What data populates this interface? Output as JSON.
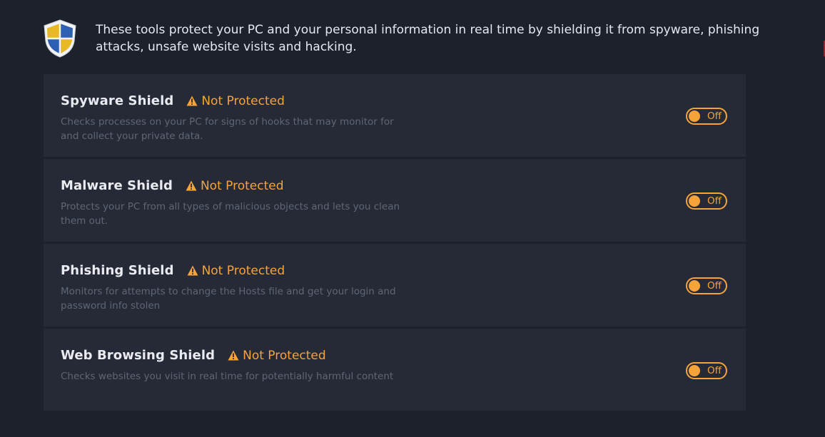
{
  "header": {
    "description": "These tools protect your PC and your personal information in real time by shielding it from spyware, phishing attacks, unsafe website visits and hacking.",
    "logo_icon": "shield-logo-icon"
  },
  "colors": {
    "background": "#1d212c",
    "card": "#262a37",
    "accent": "#f6a33a",
    "title": "#e9ebf0",
    "description": "#5f6677"
  },
  "shields": [
    {
      "title": "Spyware Shield",
      "status": "Not Protected",
      "status_icon": "warning-icon",
      "description": "Checks processes on your PC for signs of hooks that may monitor for and collect your private data.",
      "toggle_label": "Off",
      "enabled": false
    },
    {
      "title": "Malware Shield",
      "status": "Not Protected",
      "status_icon": "warning-icon",
      "description": "Protects your PC from all types of malicious objects and lets you clean them out.",
      "toggle_label": "Off",
      "enabled": false
    },
    {
      "title": "Phishing Shield",
      "status": "Not Protected",
      "status_icon": "warning-icon",
      "description": "Monitors for attempts to change the Hosts file and get your login and password info stolen",
      "toggle_label": "Off",
      "enabled": false
    },
    {
      "title": "Web Browsing Shield",
      "status": "Not Protected",
      "status_icon": "warning-icon",
      "description": "Checks websites you visit in real time for potentially harmful content",
      "toggle_label": "Off",
      "enabled": false
    }
  ]
}
